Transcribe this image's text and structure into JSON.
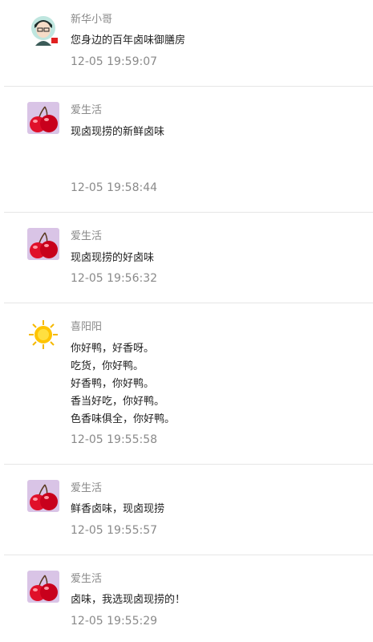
{
  "comments": [
    {
      "user": "新华小哥",
      "avatar_icon": "cartoon-man-avatar-icon",
      "lines": [
        "您身边的百年卤味御膳房"
      ],
      "time": "12-05 19:59:07"
    },
    {
      "user": "爱生活",
      "avatar_icon": "cherry-avatar-icon",
      "lines": [
        "现卤现捞的新鲜卤味"
      ],
      "time": "12-05 19:58:44"
    },
    {
      "user": "爱生活",
      "avatar_icon": "cherry-avatar-icon",
      "lines": [
        "现卤现捞的好卤味"
      ],
      "time": "12-05 19:56:32"
    },
    {
      "user": "喜阳阳",
      "avatar_icon": "sun-avatar-icon",
      "lines": [
        "你好鸭，好香呀。",
        "吃货，你好鸭。",
        "好香鸭，你好鸭。",
        "香当好吃，你好鸭。",
        "色香味俱全，你好鸭。"
      ],
      "time": "12-05 19:55:58"
    },
    {
      "user": "爱生活",
      "avatar_icon": "cherry-avatar-icon",
      "lines": [
        "鲜香卤味，现卤现捞"
      ],
      "time": "12-05 19:55:57"
    },
    {
      "user": "爱生活",
      "avatar_icon": "cherry-avatar-icon",
      "lines": [
        "卤味，我选现卤现捞的！"
      ],
      "time": "12-05 19:55:29"
    }
  ],
  "colors": {
    "name": "#8a8a8a",
    "text": "#222222",
    "time": "#8a8a8a",
    "divider": "#e6e6e6"
  }
}
